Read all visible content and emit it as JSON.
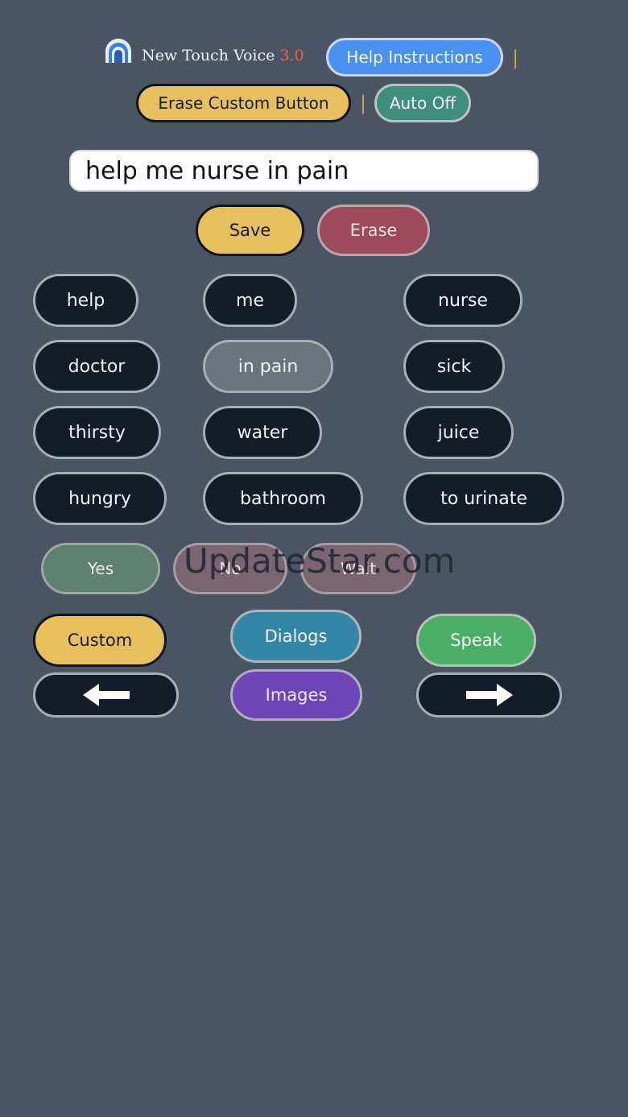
{
  "header": {
    "app_name": "New Touch Voice ",
    "version": "3.0",
    "help_label": "Help Instructions",
    "separator": "|",
    "erase_custom_label": "Erase Custom Button",
    "auto_label": "Auto Off",
    "logo_icon": "arch-speaker-logo-icon"
  },
  "sentence": {
    "value": "help me nurse in pain"
  },
  "actions": {
    "save_label": "Save",
    "erase_label": "Erase"
  },
  "words": [
    [
      "help",
      "me",
      "nurse"
    ],
    [
      "doctor",
      "in pain",
      "sick"
    ],
    [
      "thirsty",
      "water",
      "juice"
    ],
    [
      "hungry",
      "bathroom",
      "to urinate"
    ]
  ],
  "quick": {
    "yes": "Yes",
    "no": "No",
    "wait": "Wait"
  },
  "bottom": {
    "custom": "Custom",
    "dialogs": "Dialogs",
    "speak": "Speak",
    "images": "Images",
    "prev_icon": "arrow-left-icon",
    "next_icon": "arrow-right-icon"
  },
  "watermark": "UpdateStar.com",
  "colors": {
    "background": "#4b5462",
    "word_button": "#141c2a",
    "selected_word": "#6d737c",
    "help_button": "#4a90f0",
    "auto_button": "#3f8d7d",
    "save_yellow": "#e6bf5e",
    "erase_red": "#9c4a5c",
    "yes_green": "#5f7f70",
    "no_wait": "#7a6670",
    "dialogs_teal": "#3586a4",
    "speak_green": "#4cae64",
    "images_purple": "#7045b8"
  }
}
